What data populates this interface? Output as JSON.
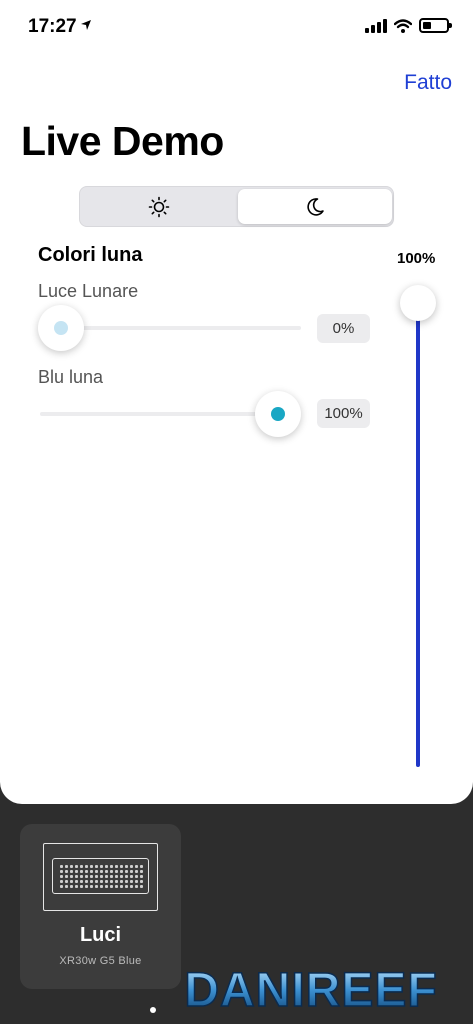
{
  "status_bar": {
    "time": "17:27",
    "location_icon": "location-arrow-icon",
    "battery_level": 0.35
  },
  "header": {
    "done_label": "Fatto",
    "title": "Live Demo"
  },
  "mode_switch": {
    "options": [
      "sun-icon",
      "moon-icon"
    ],
    "selected": "moon-icon"
  },
  "moon_colors": {
    "section_title": "Colori luna",
    "sliders": [
      {
        "label": "Luce Lunare",
        "value_text": "0%",
        "value": 0,
        "dot_color": "#c5e4f3"
      },
      {
        "label": "Blu luna",
        "value_text": "100%",
        "value": 100,
        "dot_color": "#19a7c4"
      }
    ]
  },
  "master": {
    "value_text": "100%",
    "value": 100,
    "fill_color": "#1f37c8"
  },
  "device": {
    "title": "Luci",
    "subtitle": "XR30w G5 Blue"
  },
  "watermark": {
    "text": "DANIREEF"
  },
  "colors": {
    "accent": "#1f3fd4",
    "background": "#2d2d2d"
  }
}
